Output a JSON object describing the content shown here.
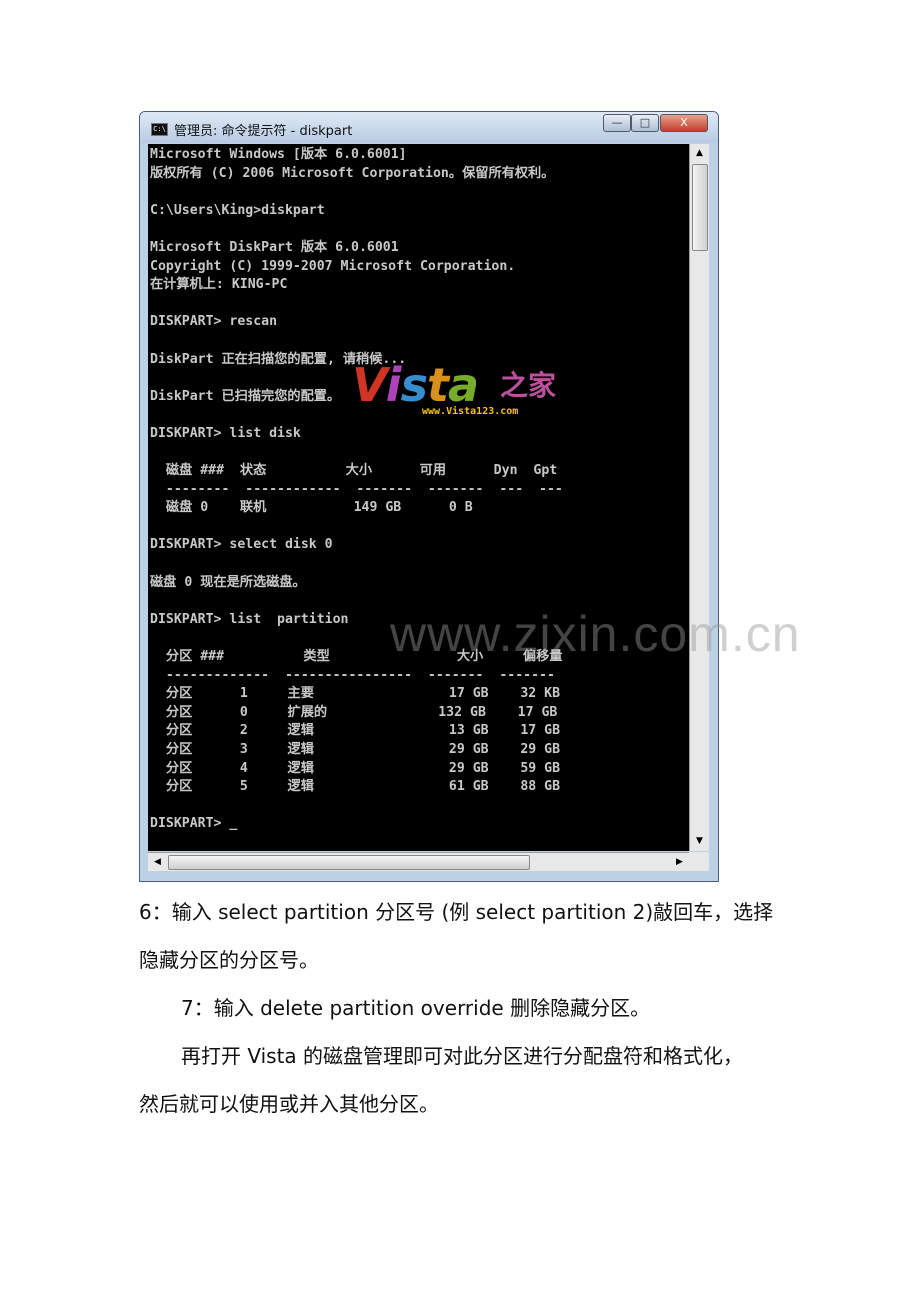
{
  "window": {
    "title": "管理员: 命令提示符 - diskpart",
    "buttons": {
      "minimize": "—",
      "maximize": "□",
      "close": "X"
    }
  },
  "console": {
    "lines": [
      "Microsoft Windows [版本 6.0.6001]",
      "版权所有 (C) 2006 Microsoft Corporation。保留所有权利。",
      "",
      "C:\\Users\\King>diskpart",
      "",
      "Microsoft DiskPart 版本 6.0.6001",
      "Copyright (C) 1999-2007 Microsoft Corporation.",
      "在计算机上: KING-PC",
      "",
      "DISKPART> rescan",
      "",
      "DiskPart 正在扫描您的配置, 请稍候...",
      "",
      "DiskPart 已扫描完您的配置。",
      "",
      "DISKPART> list disk",
      "",
      "  磁盘 ###  状态          大小      可用      Dyn  Gpt",
      "  --------  ------------  -------  -------  ---  ---",
      "  磁盘 0    联机           149 GB      0 B",
      "",
      "DISKPART> select disk 0",
      "",
      "磁盘 0 现在是所选磁盘。",
      "",
      "DISKPART> list  partition",
      "",
      "  分区 ###          类型                大小     偏移量",
      "  -------------  ----------------  -------  -------",
      "  分区      1     主要                 17 GB    32 KB",
      "  分区      0     扩展的              132 GB    17 GB",
      "  分区      2     逻辑                 13 GB    17 GB",
      "  分区      3     逻辑                 29 GB    29 GB",
      "  分区      4     逻辑                 29 GB    59 GB",
      "  分区      5     逻辑                 61 GB    88 GB",
      "",
      "DISKPART> _"
    ]
  },
  "logo": {
    "brand": "Vista",
    "suffix": "之家",
    "url": "www.Vista123.com"
  },
  "watermark": "www.zixin.com.cn",
  "paragraphs": [
    "6：输入 select partition  分区号  (例 select partition 2)敲回车，选择",
    "隐藏分区的分区号。",
    "7：输入 delete partition override  删除隐藏分区。",
    "再打开 Vista 的磁盘管理即可对此分区进行分配盘符和格式化，",
    "然后就可以使用或并入其他分区。"
  ]
}
